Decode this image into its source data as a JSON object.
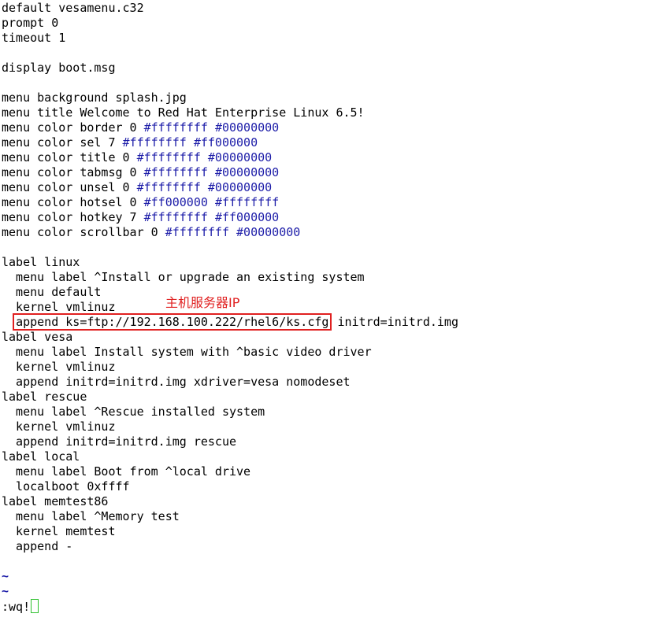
{
  "editor": {
    "lines": [
      "default vesamenu.c32",
      "prompt 0",
      "timeout 1",
      "",
      "display boot.msg",
      "",
      "menu background splash.jpg",
      "menu title Welcome to Red Hat Enterprise Linux 6.5!",
      "menu color border 0 #ffffffff #00000000",
      "menu color sel 7 #ffffffff #ff000000",
      "menu color title 0 #ffffffff #00000000",
      "menu color tabmsg 0 #ffffffff #00000000",
      "menu color unsel 0 #ffffffff #00000000",
      "menu color hotsel 0 #ff000000 #ffffffff",
      "menu color hotkey 7 #ffffffff #ff000000",
      "menu color scrollbar 0 #ffffffff #00000000",
      "",
      "label linux",
      "  menu label ^Install or upgrade an existing system",
      "  menu default",
      "  kernel vmlinuz",
      "  append ks=ftp://192.168.100.222/rhel6/ks.cfg initrd=initrd.img",
      "label vesa",
      "  menu label Install system with ^basic video driver",
      "  kernel vmlinuz",
      "  append initrd=initrd.img xdriver=vesa nomodeset",
      "label rescue",
      "  menu label ^Rescue installed system",
      "  kernel vmlinuz",
      "  append initrd=initrd.img rescue",
      "label local",
      "  menu label Boot from ^local drive",
      "  localboot 0xffff",
      "label memtest86",
      "  menu label ^Memory test",
      "  kernel memtest",
      "  append -",
      "",
      "~",
      "~"
    ],
    "highlight": {
      "line": 21,
      "text": "append ks=ftp://192.168.100.222/rhel6/ks.cfg"
    },
    "command_line": ":wq!"
  },
  "annotation": {
    "text": "主机服务器IP",
    "color": "#e02020"
  },
  "colors": {
    "hex_literal": "#1c1ca8",
    "tilde": "#1c1ca8",
    "cursor": "#2ec02e",
    "highlight_box": "#e02020"
  }
}
